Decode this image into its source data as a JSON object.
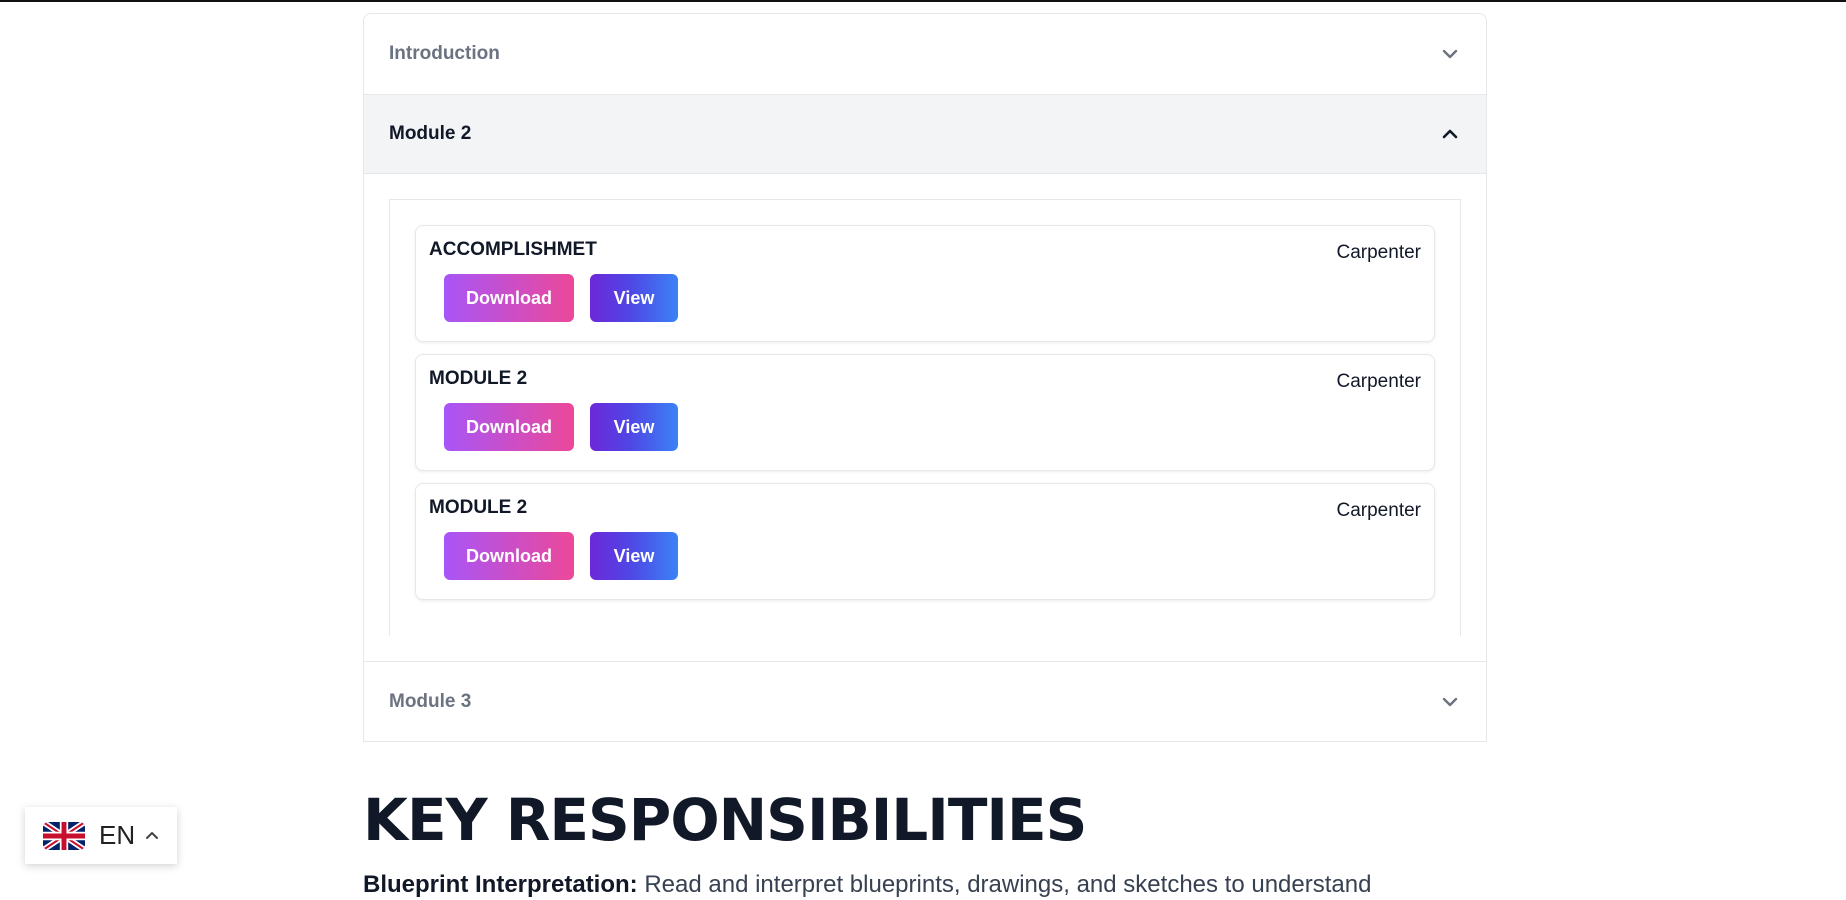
{
  "accordion": {
    "sections": [
      {
        "title": "Introduction",
        "expanded": false
      },
      {
        "title": "Module 2",
        "expanded": true
      },
      {
        "title": "Module 3",
        "expanded": false
      }
    ],
    "files": [
      {
        "name": "ACCOMPLISHMET",
        "trade": "Carpenter",
        "download_label": "Download",
        "view_label": "View"
      },
      {
        "name": "MODULE 2",
        "trade": "Carpenter",
        "download_label": "Download",
        "view_label": "View"
      },
      {
        "name": "MODULE 2",
        "trade": "Carpenter",
        "download_label": "Download",
        "view_label": "View"
      }
    ]
  },
  "responsibilities": {
    "heading": "KEY RESPONSIBILITIES",
    "item_title": "Blueprint Interpretation:",
    "item_text": " Read and interpret blueprints, drawings, and sketches to understand"
  },
  "language_switcher": {
    "code": "EN",
    "flag_icon": "uk-flag-icon",
    "caret_icon": "chevron-up-icon"
  },
  "colors": {
    "download_gradient": [
      "#a855f7",
      "#ec4899"
    ],
    "view_gradient": [
      "#6d28d9",
      "#3b82f6"
    ]
  }
}
